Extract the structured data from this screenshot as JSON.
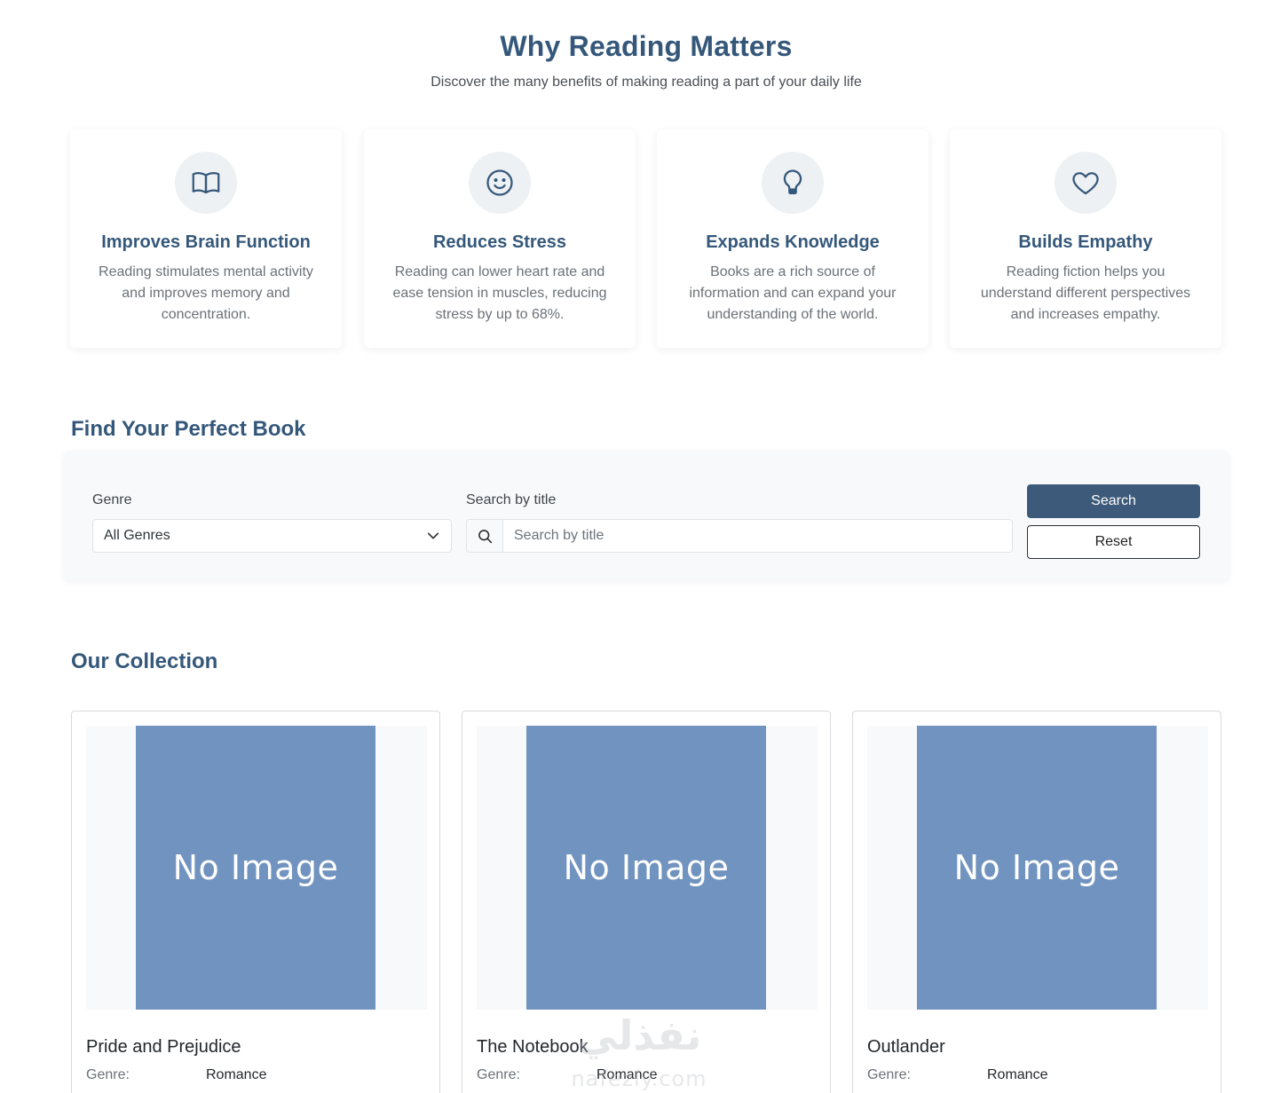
{
  "benefits": {
    "title": "Why Reading Matters",
    "subtitle": "Discover the many benefits of making reading a part of your daily life",
    "items": [
      {
        "icon": "book-open-icon",
        "title": "Improves Brain Function",
        "text": "Reading stimulates mental activity and improves memory and concentration."
      },
      {
        "icon": "smile-icon",
        "title": "Reduces Stress",
        "text": "Reading can lower heart rate and ease tension in muscles, reducing stress by up to 68%."
      },
      {
        "icon": "lightbulb-icon",
        "title": "Expands Knowledge",
        "text": "Books are a rich source of information and can expand your understanding of the world."
      },
      {
        "icon": "heart-icon",
        "title": "Builds Empathy",
        "text": "Reading fiction helps you understand different perspectives and increases empathy."
      }
    ]
  },
  "finder": {
    "title": "Find Your Perfect Book",
    "genre_label": "Genre",
    "genre_value": "All Genres",
    "search_label": "Search by title",
    "search_placeholder": "Search by title",
    "search_button": "Search",
    "reset_button": "Reset"
  },
  "collection": {
    "title": "Our Collection",
    "books": [
      {
        "cover_text": "No Image",
        "title": "Pride and Prejudice",
        "genre_label": "Genre:",
        "genre": "Romance"
      },
      {
        "cover_text": "No Image",
        "title": "The Notebook",
        "genre_label": "Genre:",
        "genre": "Romance"
      },
      {
        "cover_text": "No Image",
        "title": "Outlander",
        "genre_label": "Genre:",
        "genre": "Romance"
      }
    ]
  },
  "watermark": {
    "arabic": "نفذلي",
    "latin": "nafezly.com"
  },
  "colors": {
    "accent": "#35587a",
    "button": "#3d5a7a",
    "placeholder_cover": "#7093bf"
  }
}
